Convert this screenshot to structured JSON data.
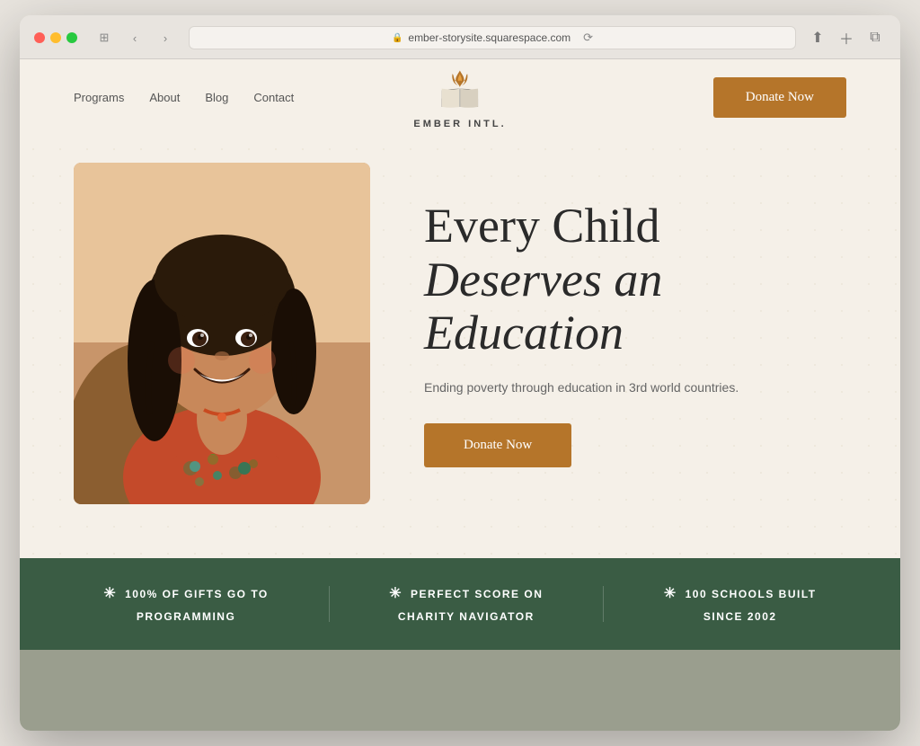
{
  "browser": {
    "url": "ember-storysite.squarespace.com",
    "reload_label": "⟳"
  },
  "nav": {
    "links": [
      {
        "label": "Programs",
        "id": "programs"
      },
      {
        "label": "About",
        "id": "about"
      },
      {
        "label": "Blog",
        "id": "blog"
      },
      {
        "label": "Contact",
        "id": "contact"
      }
    ],
    "logo_name": "EMBER INTL.",
    "donate_label": "Donate Now"
  },
  "hero": {
    "title_line1": "Every Child",
    "title_line2": "Deserves an",
    "title_line3": "Education",
    "subtitle": "Ending poverty through education in 3rd world countries.",
    "donate_label": "Donate Now"
  },
  "stats": [
    {
      "icon": "✳",
      "text_line1": "100% OF GIFTS GO TO",
      "text_line2": "PROGRAMMING"
    },
    {
      "icon": "✳",
      "text_line1": "PERFECT SCORE ON",
      "text_line2": "CHARITY NAVIGATOR"
    },
    {
      "icon": "✳",
      "text_line1": "100 SCHOOLS BUILT",
      "text_line2": "SINCE 2002"
    }
  ],
  "colors": {
    "donate_btn": "#b5752a",
    "stats_bg": "#3a5c44",
    "bottom_bg": "#9a9e8e",
    "site_bg": "#f5f0e8"
  }
}
